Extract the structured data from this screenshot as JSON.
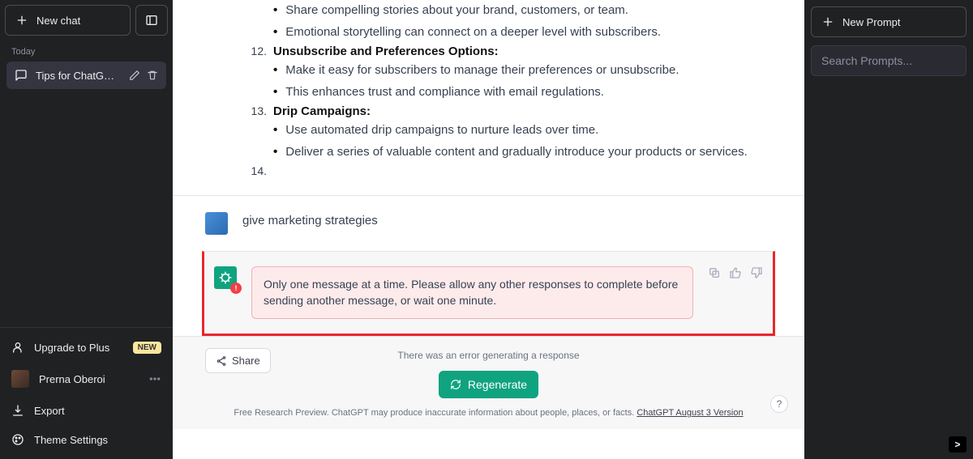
{
  "sidebar": {
    "new_chat": "New chat",
    "section_today": "Today",
    "thread_title": "Tips for ChatGPT Errors",
    "upgrade": "Upgrade to Plus",
    "upgrade_badge": "NEW",
    "user_name": "Prerna Oberoi",
    "export": "Export",
    "theme": "Theme Settings"
  },
  "content": {
    "point11_b1": "Share compelling stories about your brand, customers, or team.",
    "point11_b2": "Emotional storytelling can connect on a deeper level with subscribers.",
    "n12": "12.",
    "h12": "Unsubscribe and Preferences Options:",
    "p12_b1": "Make it easy for subscribers to manage their preferences or unsubscribe.",
    "p12_b2": "This enhances trust and compliance with email regulations.",
    "n13": "13.",
    "h13": "Drip Campaigns:",
    "p13_b1": "Use automated drip campaigns to nurture leads over time.",
    "p13_b2": "Deliver a series of valuable content and gradually introduce your products or services.",
    "n14": "14."
  },
  "user_msg": "give marketing strategies",
  "error_msg": "Only one message at a time. Please allow any other responses to complete before sending another message, or wait one minute.",
  "footer": {
    "share": "Share",
    "error_line": "There was an error generating a response",
    "regenerate": "Regenerate",
    "disclaimer_a": "Free Research Preview. ChatGPT may produce inaccurate information about people, places, or facts. ",
    "disclaimer_link": "ChatGPT August 3 Version",
    "help": "?"
  },
  "right": {
    "new_prompt": "New Prompt",
    "search_placeholder": "Search Prompts...",
    "caret": ">"
  }
}
